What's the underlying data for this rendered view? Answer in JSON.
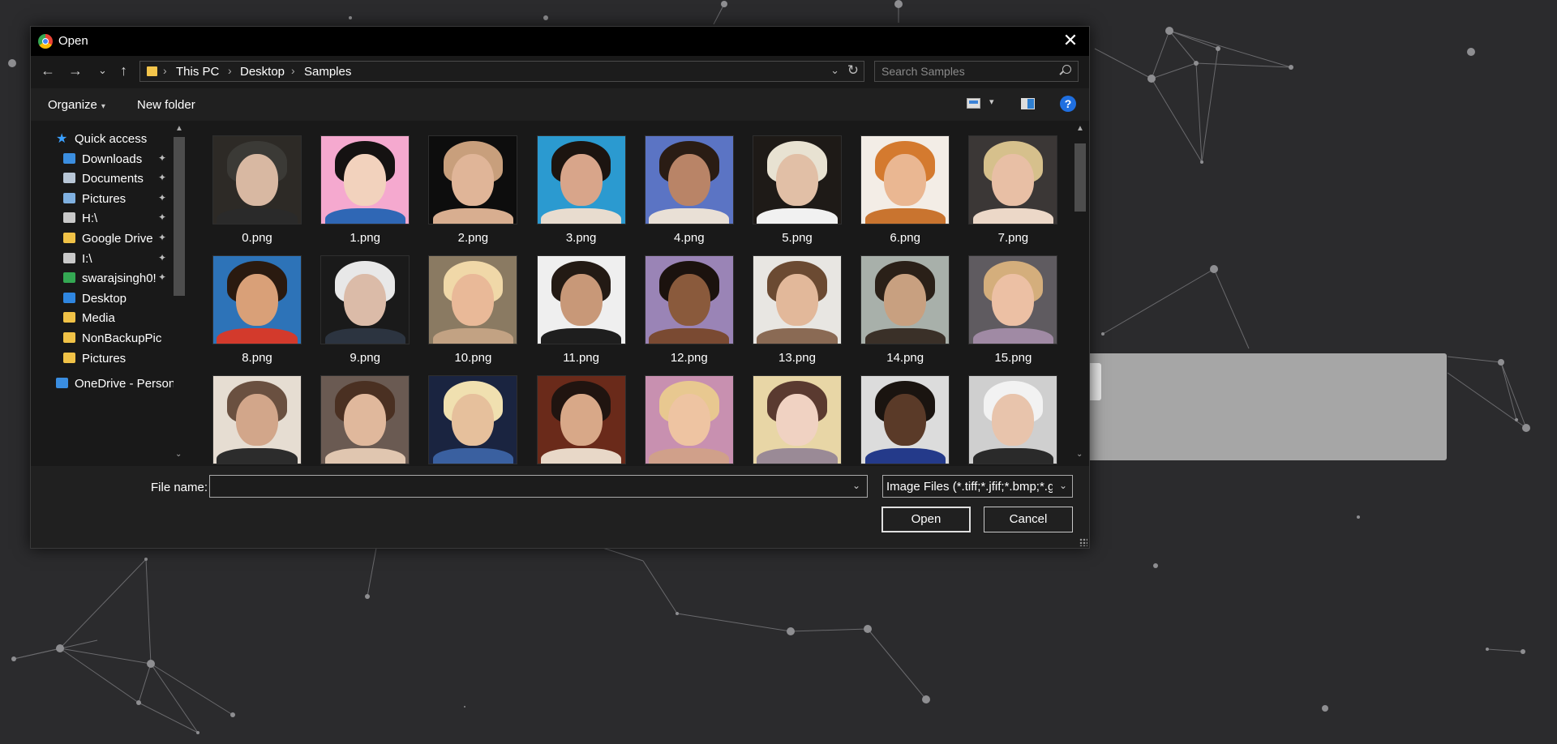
{
  "dialog": {
    "title": "Open",
    "close_glyph": "✕"
  },
  "nav": {
    "back_glyph": "←",
    "forward_glyph": "→",
    "recent_glyph": "⌄",
    "up_glyph": "↑",
    "breadcrumbs": [
      "This PC",
      "Desktop",
      "Samples"
    ],
    "separator": "›",
    "dropdown_glyph": "⌄",
    "refresh_glyph": "↻",
    "search_placeholder": "Search Samples"
  },
  "toolbar": {
    "organize_label": "Organize",
    "organize_caret": "▾",
    "new_folder_label": "New folder",
    "view_caret": "▾",
    "help_glyph": "?"
  },
  "sidebar": {
    "scroll_up": "▲",
    "scroll_down": "⌄",
    "pin_glyph": "✦",
    "items": [
      {
        "label": "Quick access",
        "icon": "star-icon",
        "color": "#3aa0ff",
        "pinned": false,
        "indent": 1
      },
      {
        "label": "Downloads",
        "icon": "download-icon",
        "color": "#3b8ee0",
        "pinned": true,
        "indent": 2
      },
      {
        "label": "Documents",
        "icon": "document-icon",
        "color": "#b8c6d6",
        "pinned": true,
        "indent": 2
      },
      {
        "label": "Pictures",
        "icon": "pictures-icon",
        "color": "#7fb0e0",
        "pinned": true,
        "indent": 2
      },
      {
        "label": "H:\\",
        "icon": "network-drive-icon",
        "color": "#c9c9c9",
        "pinned": true,
        "indent": 2
      },
      {
        "label": "Google Drive",
        "icon": "folder-icon",
        "color": "#f0c247",
        "pinned": true,
        "indent": 2
      },
      {
        "label": "I:\\",
        "icon": "network-drive-icon",
        "color": "#c9c9c9",
        "pinned": true,
        "indent": 2
      },
      {
        "label": "swarajsingh0!",
        "icon": "google-drive-icon",
        "color": "#34a853",
        "pinned": true,
        "indent": 2
      },
      {
        "label": "Desktop",
        "icon": "desktop-icon",
        "color": "#2f86e0",
        "pinned": false,
        "indent": 2
      },
      {
        "label": "Media",
        "icon": "folder-icon",
        "color": "#f0c247",
        "pinned": false,
        "indent": 2
      },
      {
        "label": "NonBackupPictu",
        "icon": "folder-icon",
        "color": "#f0c247",
        "pinned": false,
        "indent": 2
      },
      {
        "label": "Pictures",
        "icon": "folder-icon",
        "color": "#f0c247",
        "pinned": false,
        "indent": 2
      },
      {
        "label": "OneDrive - Person",
        "icon": "onedrive-icon",
        "color": "#3a8de0",
        "pinned": false,
        "indent": 1
      }
    ]
  },
  "files": {
    "scroll_up": "▲",
    "scroll_down": "⌄",
    "items": [
      {
        "name": "0.png",
        "bg": "#2d2a26",
        "skin": "#d8b8a2",
        "hair": "#3b3a36",
        "cloth": "#2a2a2a"
      },
      {
        "name": "1.png",
        "bg": "#f5a9cf",
        "skin": "#f2d2bd",
        "hair": "#151212",
        "cloth": "#2f67b5"
      },
      {
        "name": "2.png",
        "bg": "#0d0d0d",
        "skin": "#e0b598",
        "hair": "#c89f7c",
        "cloth": "#d8ae90"
      },
      {
        "name": "3.png",
        "bg": "#2b9ad0",
        "skin": "#d8a58a",
        "hair": "#1c1410",
        "cloth": "#e8dccf"
      },
      {
        "name": "4.png",
        "bg": "#5b74c4",
        "skin": "#b98467",
        "hair": "#2a1c14",
        "cloth": "#e9e0d6"
      },
      {
        "name": "5.png",
        "bg": "#1e1a17",
        "skin": "#e1bfa6",
        "hair": "#e8e2d2",
        "cloth": "#f1f1f1"
      },
      {
        "name": "6.png",
        "bg": "#f3ede6",
        "skin": "#eab792",
        "hair": "#d47a2f",
        "cloth": "#c9742f"
      },
      {
        "name": "7.png",
        "bg": "#3b3736",
        "skin": "#e8bfa5",
        "hair": "#d6c08c",
        "cloth": "#ecd8c8"
      },
      {
        "name": "8.png",
        "bg": "#2d73b8",
        "skin": "#d9a078",
        "hair": "#2a1a10",
        "cloth": "#d33a2c"
      },
      {
        "name": "9.png",
        "bg": "#1a1a1a",
        "skin": "#dbbba8",
        "hair": "#e8e8e8",
        "cloth": "#2c3440"
      },
      {
        "name": "10.png",
        "bg": "#8a7a62",
        "skin": "#e9b998",
        "hair": "#f0d8a8",
        "cloth": "#c2a283"
      },
      {
        "name": "11.png",
        "bg": "#efefef",
        "skin": "#c89878",
        "hair": "#231a14",
        "cloth": "#1e1e1e"
      },
      {
        "name": "12.png",
        "bg": "#9a84b6",
        "skin": "#8a5a3c",
        "hair": "#1b120e",
        "cloth": "#7a4a32"
      },
      {
        "name": "13.png",
        "bg": "#e8e6e2",
        "skin": "#e2b89a",
        "hair": "#6b4a32",
        "cloth": "#8a6a54"
      },
      {
        "name": "14.png",
        "bg": "#a8b0aa",
        "skin": "#c8a080",
        "hair": "#2a2018",
        "cloth": "#3a3028"
      },
      {
        "name": "15.png",
        "bg": "#5f5b60",
        "skin": "#ecc0a4",
        "hair": "#d4ae7c",
        "cloth": "#a08aa4"
      },
      {
        "name": "",
        "bg": "#e6ddd2",
        "skin": "#d2a68a",
        "hair": "#6a5040",
        "cloth": "#2c2c2c"
      },
      {
        "name": "",
        "bg": "#6a5a52",
        "skin": "#e0b89c",
        "hair": "#4a3022",
        "cloth": "#e0c6b0"
      },
      {
        "name": "",
        "bg": "#1a2440",
        "skin": "#e6c09c",
        "hair": "#f0e0b0",
        "cloth": "#3a60a0"
      },
      {
        "name": "",
        "bg": "#6a2a1a",
        "skin": "#d8a888",
        "hair": "#201410",
        "cloth": "#e8d8c8"
      },
      {
        "name": "",
        "bg": "#c890b0",
        "skin": "#eec4a2",
        "hair": "#e8c890",
        "cloth": "#d0a08a"
      },
      {
        "name": "",
        "bg": "#e8d6a6",
        "skin": "#f0d2c2",
        "hair": "#5a3a30",
        "cloth": "#9a8a96"
      },
      {
        "name": "",
        "bg": "#dcdcdc",
        "skin": "#5a3a28",
        "hair": "#1a1410",
        "cloth": "#243a8a"
      },
      {
        "name": "",
        "bg": "#cfcfcf",
        "skin": "#e8c4ac",
        "hair": "#f2f2f2",
        "cloth": "#2a2a2a"
      }
    ]
  },
  "bottom": {
    "filename_label": "File name:",
    "filename_value": "",
    "filename_dropdown": "⌄",
    "filetype_value": "Image Files (*.tiff;*.jfif;*.bmp;*.g",
    "filetype_dropdown": "⌄",
    "open_label": "Open",
    "cancel_label": "Cancel"
  }
}
